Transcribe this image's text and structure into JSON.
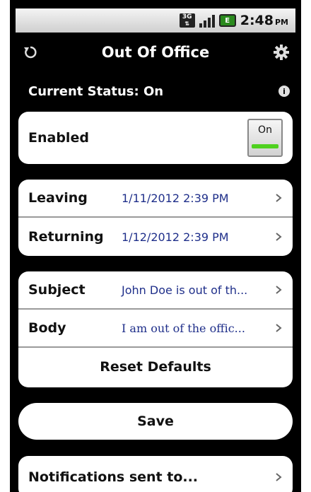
{
  "statusbar": {
    "network": "3G",
    "battery_label": "E",
    "time": "2:48",
    "ampm": "PM"
  },
  "header": {
    "title": "Out Of Office"
  },
  "current_status": {
    "label": "Current Status: On",
    "info_glyph": "i"
  },
  "enabled": {
    "label": "Enabled",
    "toggle_text": "On",
    "toggle_state": "on",
    "accent_color": "#4fd11f"
  },
  "schedule": {
    "leaving_label": "Leaving",
    "leaving_value": "1/11/2012 2:39 PM",
    "returning_label": "Returning",
    "returning_value": "1/12/2012 2:39 PM"
  },
  "message": {
    "subject_label": "Subject",
    "subject_value": "John Doe is out of th...",
    "body_label": "Body",
    "body_value": "I am out of the offic...",
    "reset_label": "Reset Defaults"
  },
  "save_label": "Save",
  "notifications_label": "Notifications sent to..."
}
